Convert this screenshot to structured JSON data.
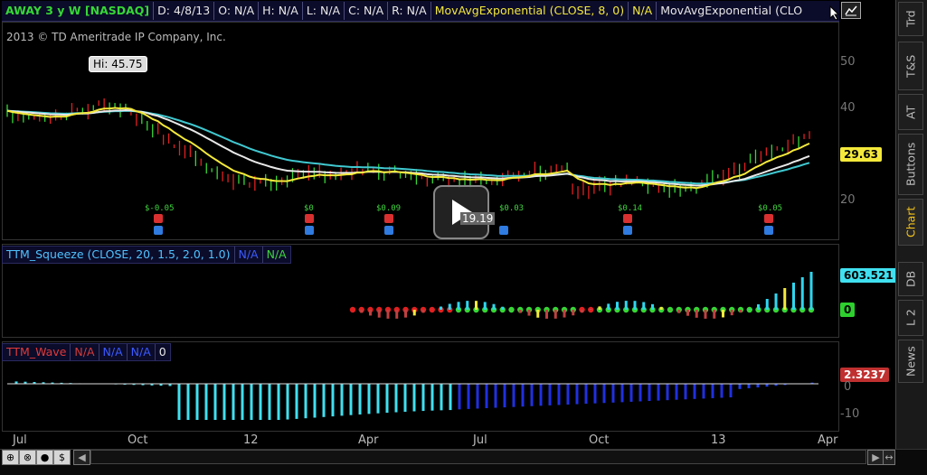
{
  "header": {
    "symbol": "AWAY 3 y W [NASDAQ]",
    "date": "D: 4/8/13",
    "open": "O: N/A",
    "high": "H: N/A",
    "low": "L: N/A",
    "close": "C: N/A",
    "range": "R: N/A",
    "study": "MovAvgExponential (CLOSE, 8, 0)",
    "study_value": "N/A",
    "study2": "MovAvgExponential (CLO"
  },
  "chart": {
    "copyright": "2013 © TD Ameritrade IP Company, Inc.",
    "hi_label": "Hi: 45.75",
    "last_price": "29.63",
    "y_axis": [
      "50",
      "40",
      "30",
      "20"
    ],
    "x_axis": [
      "Jul",
      "Oct",
      "12",
      "Apr",
      "Jul",
      "Oct",
      "13",
      "Apr"
    ],
    "covered_label": "19.19",
    "earnings": [
      "$-0.05",
      "$0",
      "$0.09",
      "$0.03",
      "$0.14",
      "$0.05"
    ]
  },
  "squeeze": {
    "name": "TTM_Squeeze (CLOSE, 20, 1.5, 2.0, 1.0)",
    "v1": "N/A",
    "v2": "N/A",
    "badge": "603.521",
    "zero_badge": "0"
  },
  "wave": {
    "name": "TTM_Wave",
    "v1": "N/A",
    "v2": "N/A",
    "v3": "N/A",
    "v4": "0",
    "badge": "2.3237",
    "y_axis": [
      "0",
      "-10"
    ]
  },
  "right_tabs": [
    "Trd",
    "T&S",
    "AT",
    "Buttons",
    "Chart",
    "DB",
    "L 2",
    "News"
  ],
  "colors": {
    "green": "#36d736",
    "yellow": "#f4e93b",
    "cyan": "#40e0f0",
    "blue": "#2030e0",
    "red": "#e02020"
  }
}
